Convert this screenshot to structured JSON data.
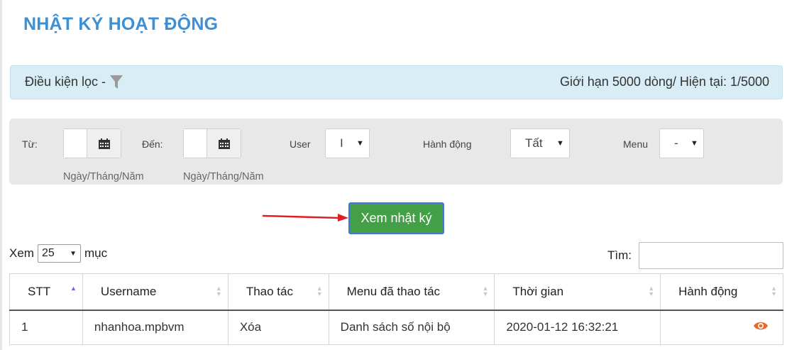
{
  "page": {
    "title": "NHẬT KÝ HOẠT ĐỘNG"
  },
  "filter_bar": {
    "label": "Điều kiện lọc -",
    "limit_text": "Giới hạn 5000 dòng/ Hiện tại: 1/5000"
  },
  "filters": {
    "from_label": "Từ:",
    "from_hint": "Ngày/Tháng/Năm",
    "to_label": "Đến:",
    "to_hint": "Ngày/Tháng/Năm",
    "user_label": "User",
    "user_value": "I",
    "action_label": "Hành động",
    "action_value": "Tất",
    "menu_label": "Menu",
    "menu_value": "-"
  },
  "view_button": {
    "label": "Xem nhật ký"
  },
  "table_controls": {
    "show_label": "Xem",
    "page_length": "25",
    "entries_label": "mục",
    "search_label": "Tìm:"
  },
  "table": {
    "columns": [
      "STT",
      "Username",
      "Thao tác",
      "Menu đã thao tác",
      "Thời gian",
      "Hành động"
    ],
    "rows": [
      {
        "stt": "1",
        "username": "nhanhoa.mpbvm",
        "operation": "Xóa",
        "menu": "Danh sách số nội bộ",
        "time": "2020-01-12 16:32:21",
        "action_icon": "eye-icon"
      }
    ]
  },
  "colors": {
    "title": "#3d8fd6",
    "filter_bar_bg": "#d9edf7",
    "panel_bg": "#e8e8e8",
    "button_green": "#43a047",
    "arrow_red": "#e02020",
    "eye_orange": "#e8692c"
  }
}
